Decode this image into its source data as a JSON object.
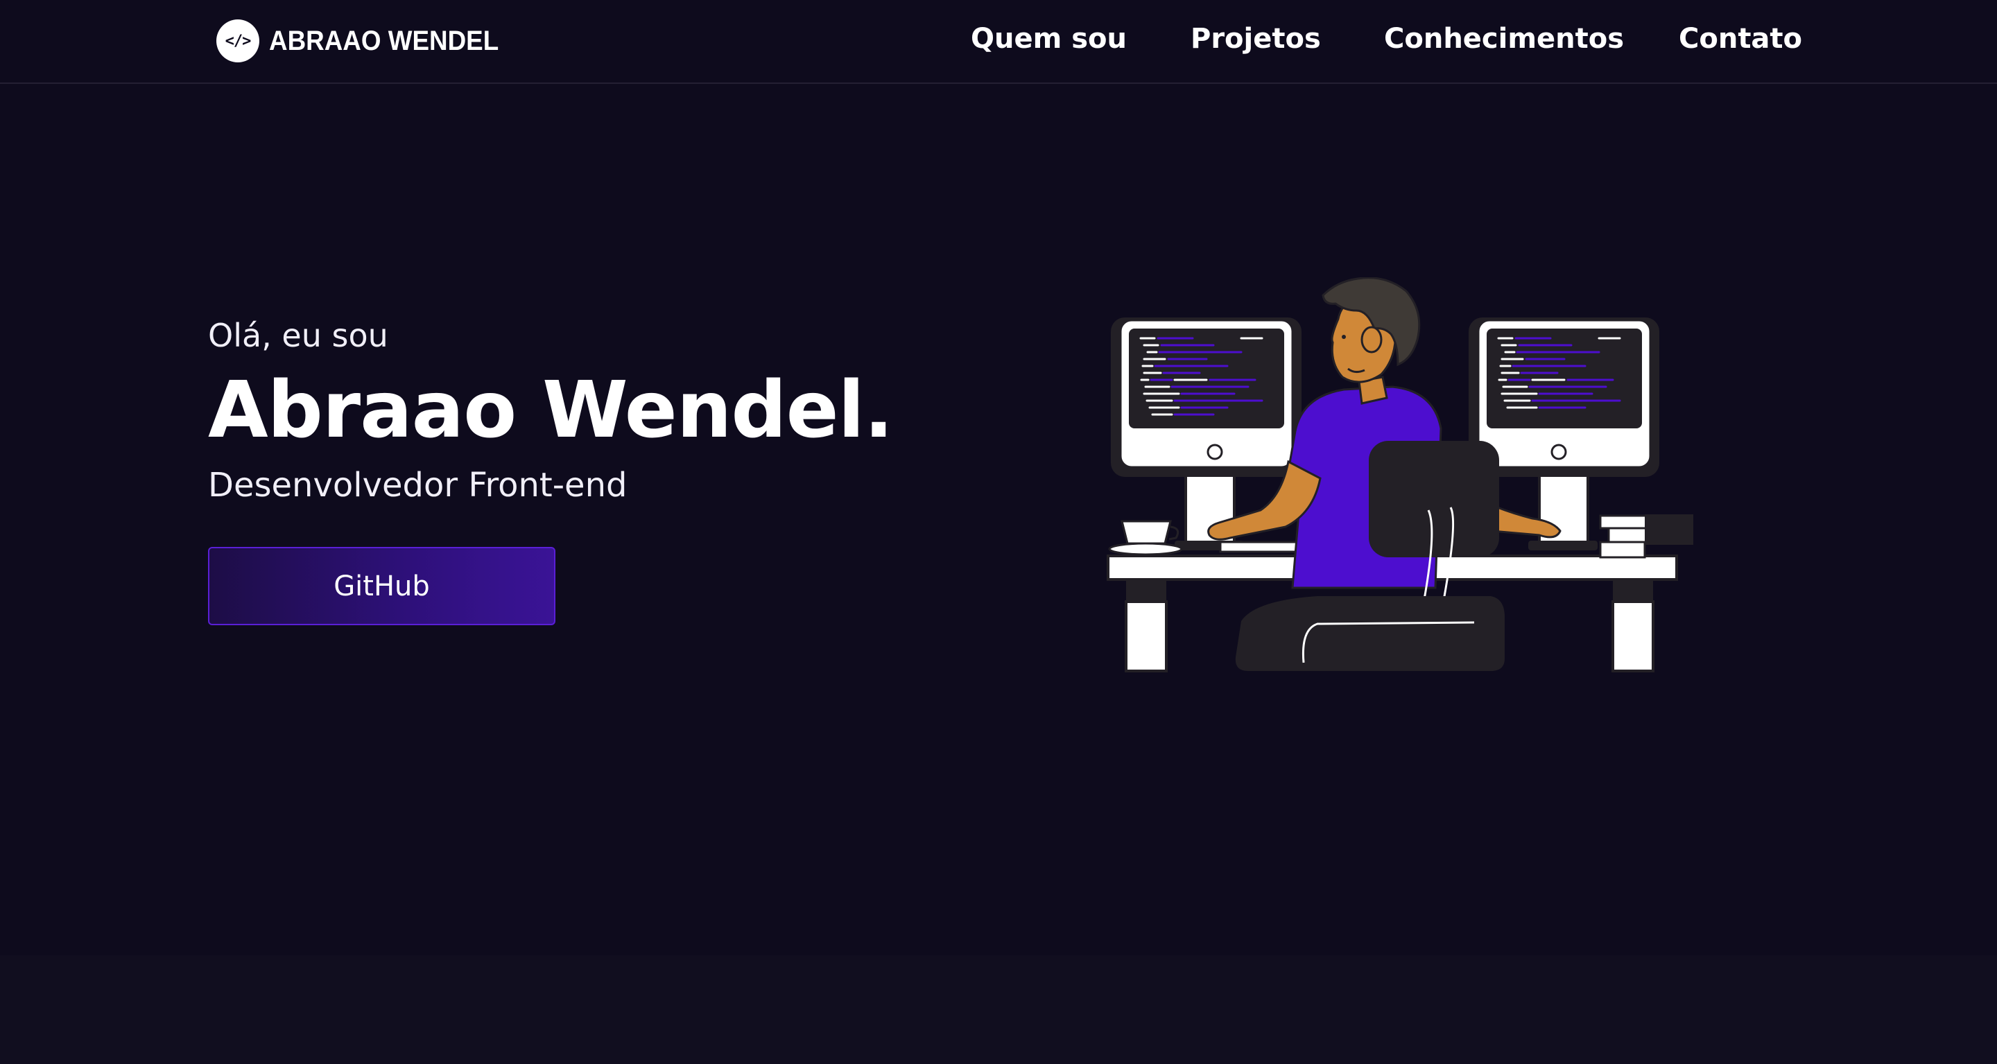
{
  "navbar": {
    "logo_badge": "</>",
    "logo_text": "ABRAAO WENDEL",
    "links": [
      {
        "label": "Quem sou"
      },
      {
        "label": "Projetos"
      },
      {
        "label": "Conhecimentos"
      },
      {
        "label": "Contato"
      }
    ]
  },
  "hero": {
    "greeting": "Olá, eu sou",
    "name": "Abraao Wendel.",
    "role": "Desenvolvedor Front-end",
    "github_button": "GitHub"
  },
  "illustration": {
    "icon": "developer-at-desk-illustration"
  },
  "colors": {
    "background": "#0e0b1d",
    "accent": "#4d0ecf",
    "text": "#ffffff"
  }
}
